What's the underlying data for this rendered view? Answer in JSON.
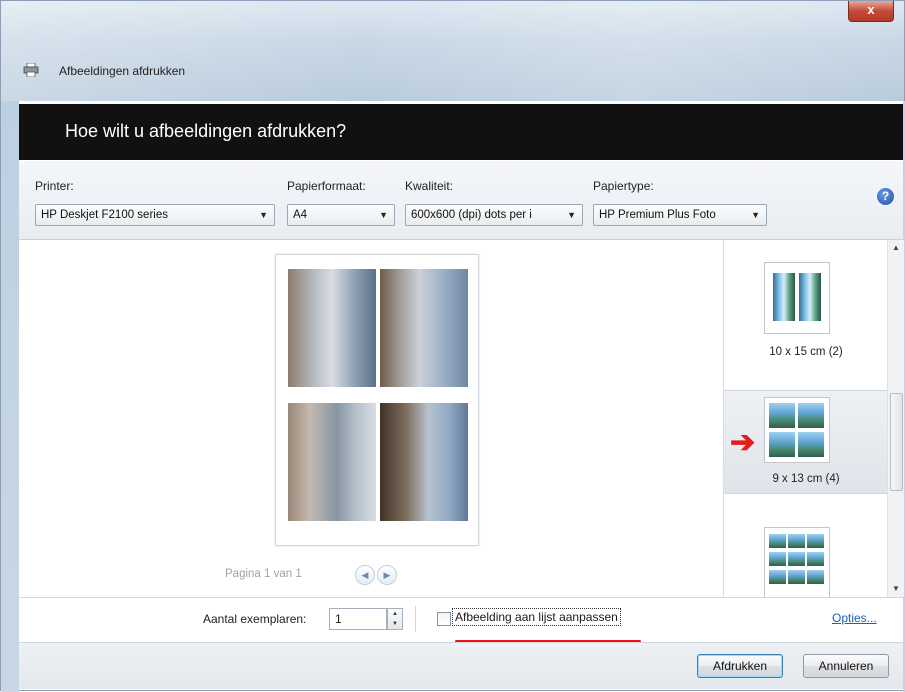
{
  "window": {
    "title": "Afbeeldingen afdrukken",
    "close_glyph": "x",
    "icon": "printer-icon"
  },
  "header": {
    "title": "Hoe wilt u afbeeldingen afdrukken?"
  },
  "options": {
    "printer": {
      "label": "Printer:",
      "value": "HP Deskjet F2100 series"
    },
    "paper_size": {
      "label": "Papierformaat:",
      "value": "A4"
    },
    "quality": {
      "label": "Kwaliteit:",
      "value": "600x600 (dpi) dots per i"
    },
    "paper_type": {
      "label": "Papiertype:",
      "value": "HP Premium Plus Foto"
    },
    "help_glyph": "?"
  },
  "preview": {
    "pager_text": "Pagina 1 van 1",
    "prev_glyph": "◀",
    "next_glyph": "▶"
  },
  "layouts": {
    "items": [
      {
        "label": "10 x 15 cm (2)",
        "selected": false
      },
      {
        "label": "9 x 13 cm (4)",
        "selected": true
      },
      {
        "label": "",
        "selected": false
      }
    ],
    "arrow_color": "#e21b1b"
  },
  "bottom": {
    "copies_label": "Aantal exemplaren:",
    "copies_value": "1",
    "fit_label": "Afbeelding aan lijst aanpassen",
    "fit_checked": false,
    "options_link": "Opties..."
  },
  "footer": {
    "print_button": "Afdrukken",
    "cancel_button": "Annuleren"
  }
}
